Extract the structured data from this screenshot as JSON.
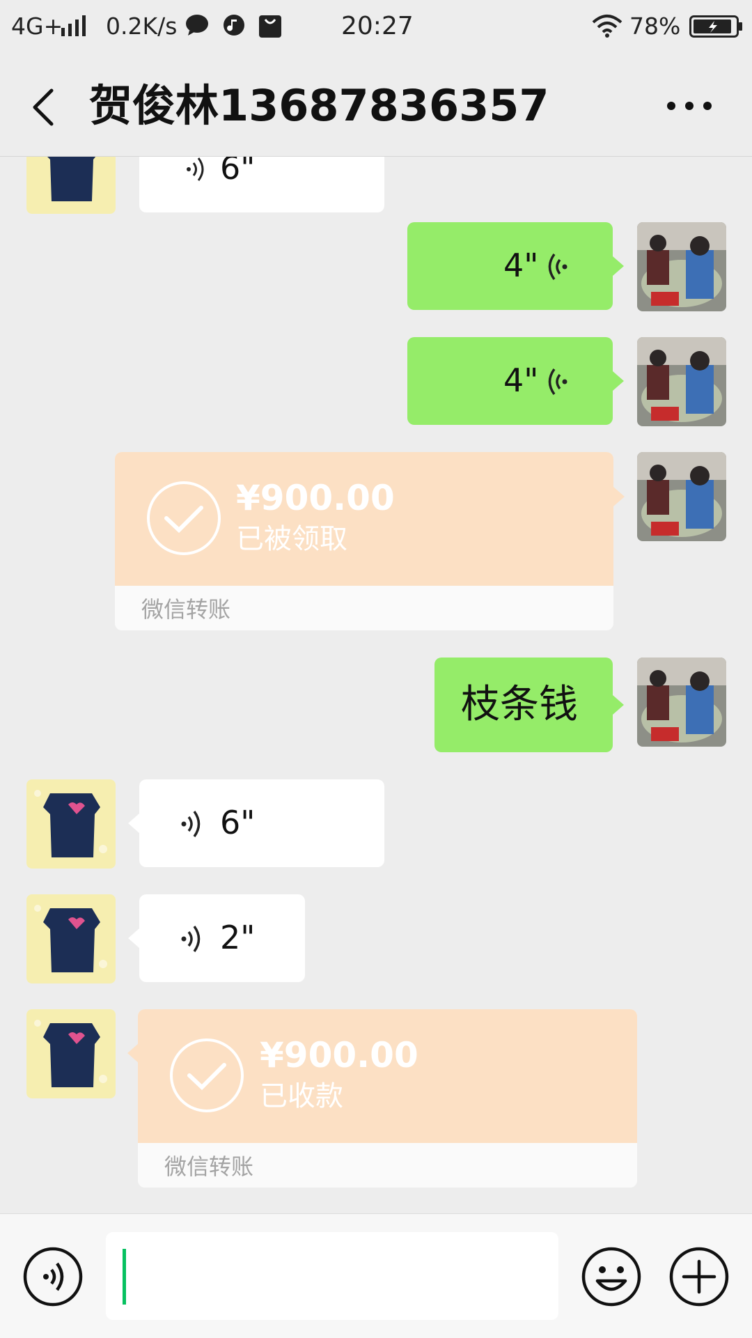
{
  "status_bar": {
    "network": "4G+",
    "speed": "0.2K/s",
    "time": "20:27",
    "battery": "78%"
  },
  "header": {
    "title": "贺俊林13687836357"
  },
  "messages": {
    "partial_voice": {
      "duration": "6\""
    },
    "voice_out_1": {
      "duration": "4\""
    },
    "voice_out_2": {
      "duration": "4\""
    },
    "transfer_out": {
      "amount": "¥900.00",
      "status": "已被领取",
      "footer": "微信转账"
    },
    "text_out": {
      "text": "枝条钱"
    },
    "voice_in_1": {
      "duration": "6\""
    },
    "voice_in_2": {
      "duration": "2\""
    },
    "transfer_in": {
      "amount": "¥900.00",
      "status": "已收款",
      "footer": "微信转账"
    }
  },
  "colors": {
    "green_bubble": "#95ec69",
    "transfer_orange": "#fce0c4",
    "cursor": "#07c160"
  }
}
